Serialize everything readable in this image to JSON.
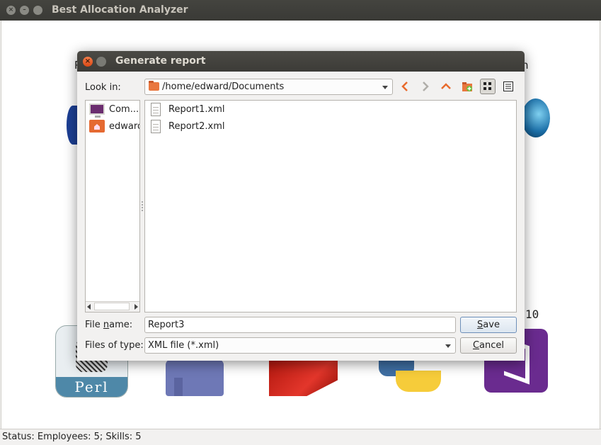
{
  "window": {
    "title": "Best Allocation Analyzer"
  },
  "background": {
    "partial_left": "P",
    "partial_right": "n",
    "partial_number": "10"
  },
  "status": {
    "text": "Status:  Employees: 5;  Skills: 5"
  },
  "dialog": {
    "title": "Generate report",
    "look_in_label": "Look in:",
    "look_in_value": "/home/edward/Documents",
    "toolbar": [
      "back-icon",
      "forward-icon",
      "parent-directory-icon",
      "new-folder-icon",
      "icon-view-icon",
      "detail-view-icon"
    ],
    "sidebar": [
      {
        "label": "Com...",
        "icon": "computer-icon"
      },
      {
        "label": "edward",
        "icon": "home-folder-icon"
      }
    ],
    "files": [
      {
        "name": "Report1.xml",
        "icon": "document-icon"
      },
      {
        "name": "Report2.xml",
        "icon": "document-icon"
      }
    ],
    "filename_label_pre": "File ",
    "filename_label_u": "n",
    "filename_label_post": "ame:",
    "filename_value": "Report3",
    "filetype_label": "Files of type:",
    "filetype_value": "XML file (*.xml)",
    "save_label": "Save",
    "cancel_label": "Cancel"
  },
  "colors": {
    "accent_orange": "#e9773f",
    "title_bar": "#3c3b37",
    "close_button": "#dd4814"
  }
}
